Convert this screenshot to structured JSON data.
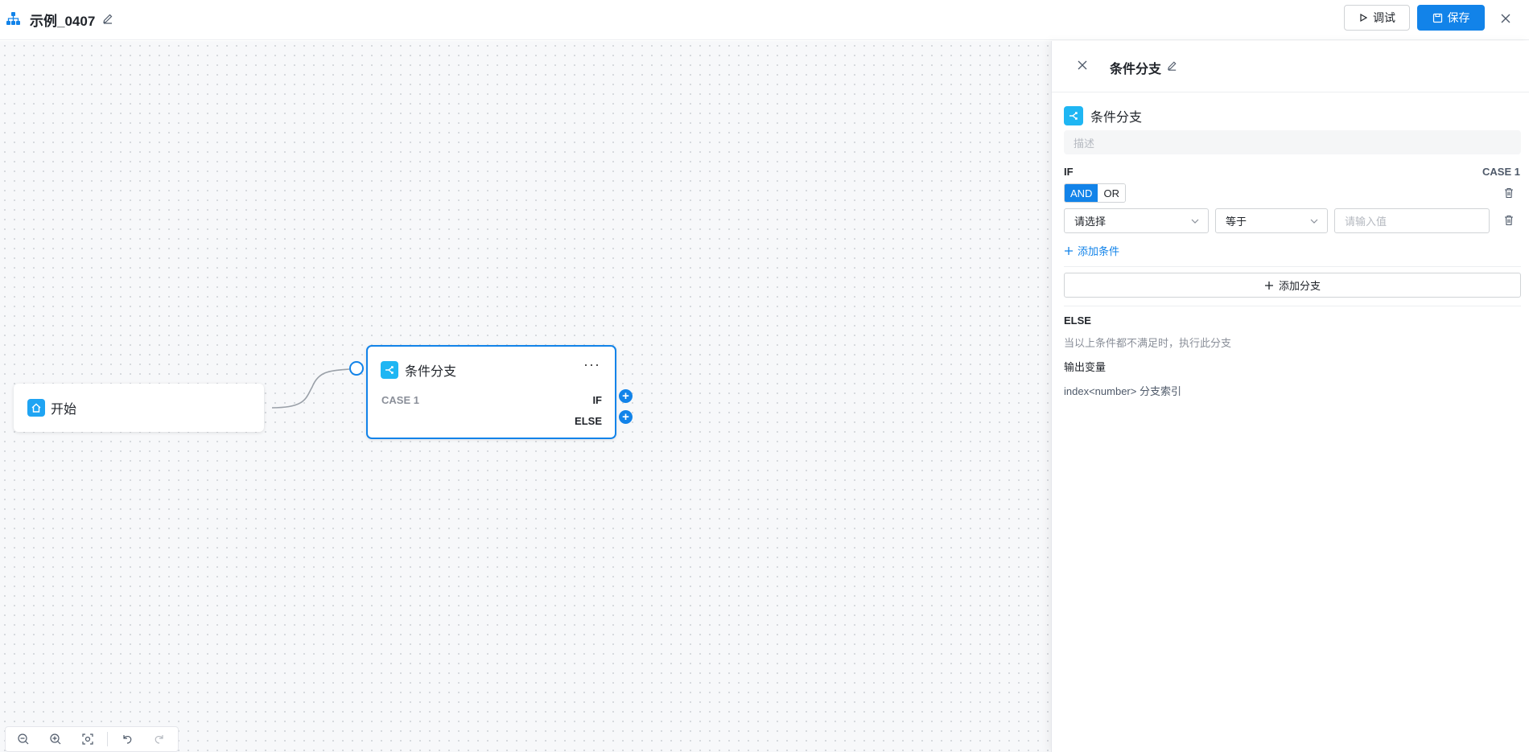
{
  "header": {
    "title": "示例_0407",
    "debug_label": "调试",
    "save_label": "保存"
  },
  "canvas": {
    "start_node": {
      "label": "开始"
    },
    "condition_node": {
      "title": "条件分支",
      "more": "···",
      "case_label": "CASE 1",
      "if_label": "IF",
      "else_label": "ELSE"
    }
  },
  "panel": {
    "title": "条件分支",
    "node_title": "条件分支",
    "description_placeholder": "描述",
    "if_label": "IF",
    "case_label": "CASE 1",
    "logic": {
      "and": "AND",
      "or": "OR",
      "selected": "AND"
    },
    "condition": {
      "field_placeholder": "请选择",
      "operator": "等于",
      "value_placeholder": "请输入值"
    },
    "add_condition": "添加条件",
    "add_branch": "添加分支",
    "else_label": "ELSE",
    "else_desc": "当以上条件都不满足时，执行此分支",
    "output_label": "输出变量",
    "output_var": "index<number> 分支索引"
  },
  "colors": {
    "accent": "#1283e9",
    "node_icon": "#1fb6f3"
  }
}
